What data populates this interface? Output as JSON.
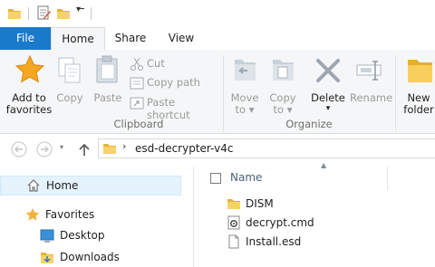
{
  "tabs": {
    "file": "File",
    "home": "Home",
    "share": "Share",
    "view": "View"
  },
  "ribbon": {
    "add_to_favorites_1": "Add to",
    "add_to_favorites_2": "favorites",
    "copy": "Copy",
    "paste": "Paste",
    "cut": "Cut",
    "copy_path": "Copy path",
    "paste_shortcut": "Paste shortcut",
    "move_to_1": "Move",
    "move_to_2": "to ▾",
    "copy_to_1": "Copy",
    "copy_to_2": "to ▾",
    "delete": "Delete",
    "delete_arrow": "▾",
    "rename": "Rename",
    "new_folder_1": "New",
    "new_folder_2": "folder",
    "group_clipboard": "Clipboard",
    "group_organize": "Organize"
  },
  "address": {
    "path": "esd-decrypter-v4c"
  },
  "nav": {
    "home": "Home",
    "favorites": "Favorites",
    "desktop": "Desktop",
    "downloads": "Downloads"
  },
  "filelist": {
    "column_name": "Name",
    "items": [
      {
        "name": "DISM",
        "icon": "folder-icon"
      },
      {
        "name": "decrypt.cmd",
        "icon": "cmd-file-icon"
      },
      {
        "name": "Install.esd",
        "icon": "file-icon"
      }
    ]
  },
  "colors": {
    "accent": "#1979ca",
    "folder": "#f3c243",
    "selection": "#e5f3ff"
  }
}
